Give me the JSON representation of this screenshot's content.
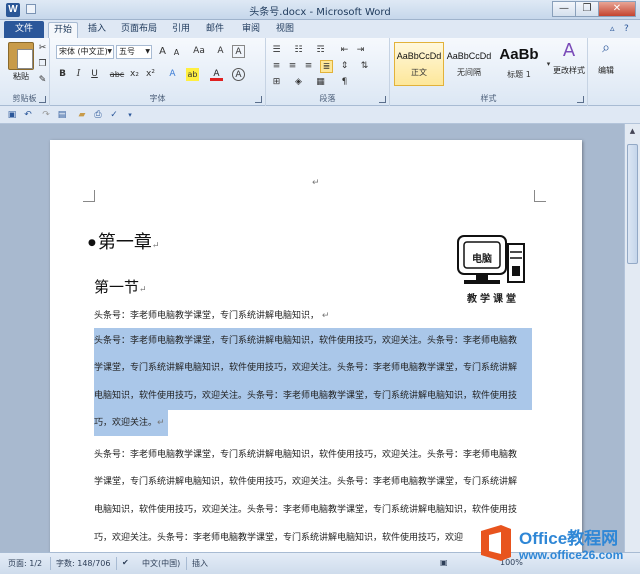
{
  "window": {
    "title": "头条号.docx - Microsoft Word",
    "app_icon": "W",
    "minimize": "—",
    "restore": "❐",
    "close": "✕"
  },
  "tabs": {
    "file": "文件",
    "items": [
      "开始",
      "插入",
      "页面布局",
      "引用",
      "邮件",
      "审阅",
      "视图"
    ]
  },
  "ribbon": {
    "clipboard": {
      "paste": "粘贴",
      "label": "剪贴板"
    },
    "font": {
      "font_name": "宋体 (中文正)",
      "font_size": "五号",
      "grow": "A",
      "shrink": "A",
      "change_case": "Aa",
      "clear": "A",
      "bold": "B",
      "italic": "I",
      "underline": "U",
      "strike": "abc",
      "subscript": "x₂",
      "superscript": "x²",
      "effects": "A",
      "highlight": "ab",
      "color": "A",
      "char_border": "A",
      "label": "字体"
    },
    "paragraph": {
      "label": "段落"
    },
    "styles": {
      "items": [
        {
          "preview": "AaBbCcDd",
          "name": "正文"
        },
        {
          "preview": "AaBbCcDd",
          "name": "无间隔"
        },
        {
          "preview": "AaBb",
          "name": "标题 1"
        }
      ],
      "change_styles": "更改样式",
      "label": "样式"
    },
    "editing": {
      "label": "编辑"
    }
  },
  "document": {
    "heading1": "第一章",
    "heading2": "第一节",
    "para_mark": "↵",
    "lines": [
      "头条号：李老师电脑教学课堂，专门系统讲解电脑知识，",
      "头条号：李老师电脑教学课堂，专门系统讲解电脑知识，软件使用技巧，欢迎关注。头条号：李老师电脑教",
      "学课堂，专门系统讲解电脑知识，软件使用技巧，欢迎关注。头条号：李老师电脑教学课堂，专门系统讲解",
      "电脑知识，软件使用技巧，欢迎关注。头条号：李老师电脑教学课堂，专门系统讲解电脑知识，软件使用技",
      "巧，欢迎关注。",
      "头条号：李老师电脑教学课堂，专门系统讲解电脑知识，软件使用技巧，欢迎关注。头条号：李老师电脑教",
      "学课堂，专门系统讲解电脑知识，软件使用技巧，欢迎关注。头条号：李老师电脑教学课堂，专门系统讲解",
      "电脑知识，软件使用技巧，欢迎关注。头条号：李老师电脑教学课堂，专门系统讲解电脑知识，软件使用技",
      "巧，欢迎关注。头条号：李老师电脑教学课堂，专门系统讲解电脑知识，软件使用技巧，欢迎"
    ],
    "logo": {
      "screen_text": "电脑",
      "caption": "教学课堂"
    }
  },
  "status": {
    "page": "页面: 1/2",
    "words": "字数: 148/706",
    "language": "中文(中国)",
    "insert": "插入",
    "zoom": "100%"
  },
  "watermark": {
    "brand": "Office教程网",
    "url": "www.office26.com"
  }
}
